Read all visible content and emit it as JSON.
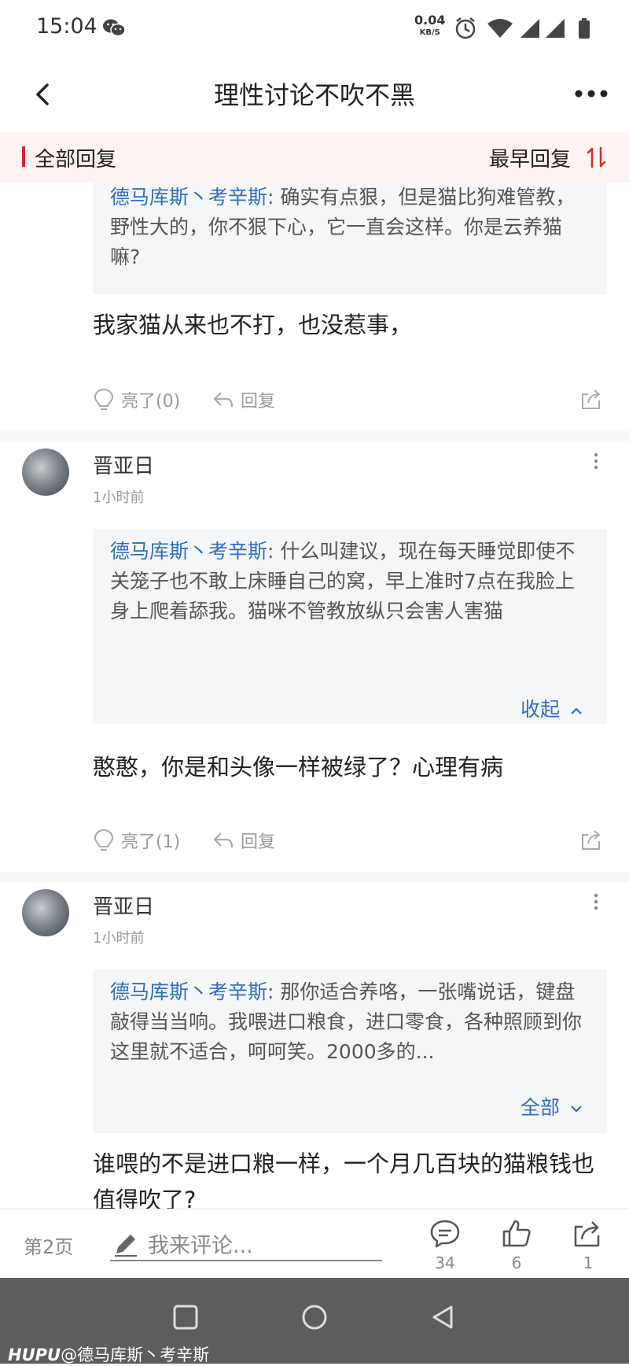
{
  "status_bar": {
    "time": "15:04",
    "net_speed": "0.04",
    "net_speed_unit": "KB/S",
    "icons": [
      "wechat-icon",
      "alarm-icon",
      "wifi-icon",
      "signal-icon",
      "signal-icon",
      "battery-icon"
    ]
  },
  "header": {
    "title": "理性讨论不吹不黑"
  },
  "sort_bar": {
    "filter_label": "全部回复",
    "order_label": "最早回复",
    "accent": "#d7262d"
  },
  "posts": [
    {
      "quote_user": "德马库斯丶考辛斯",
      "quote_text": "确实有点狠，但是猫比狗难管教，野性大的，你不狠下心，它一直会这样。你是云养猫嘛?",
      "body": "我家猫从来也不打，也没惹事，",
      "light_label": "亮了(0)",
      "reply_label": "回复"
    },
    {
      "username": "晋亚日",
      "time": "1小时前",
      "quote_user": "德马库斯丶考辛斯",
      "quote_text": "什么叫建议，现在每天睡觉即使不关笼子也不敢上床睡自己的窝，早上准时7点在我脸上身上爬着舔我。猫咪不管教放纵只会害人害猫",
      "quote_toggle": "收起",
      "body": "憨憨，你是和头像一样被绿了？心理有病",
      "light_label": "亮了(1)",
      "reply_label": "回复"
    },
    {
      "username": "晋亚日",
      "time": "1小时前",
      "quote_user": "德马库斯丶考辛斯",
      "quote_text": "那你适合养咯，一张嘴说话，键盘敲得当当响。我喂进口粮食，进口零食，各种照顾到你这里就不适合，呵呵笑。2000多的...",
      "quote_toggle": "全部",
      "body": "谁喂的不是进口粮一样，一个月几百块的猫粮钱也值得吹了?"
    }
  ],
  "bottom_bar": {
    "page_label": "第2页",
    "comment_placeholder": "我来评论...",
    "comments_count": "34",
    "likes_count": "6",
    "shares_count": "1"
  },
  "watermark": {
    "brand": "HUPU",
    "text": "@德马库斯丶考辛斯"
  },
  "colors": {
    "link_blue": "#2f6eba",
    "quote_bg": "#f5f6f8",
    "nav_bg": "#5d5d5d"
  }
}
